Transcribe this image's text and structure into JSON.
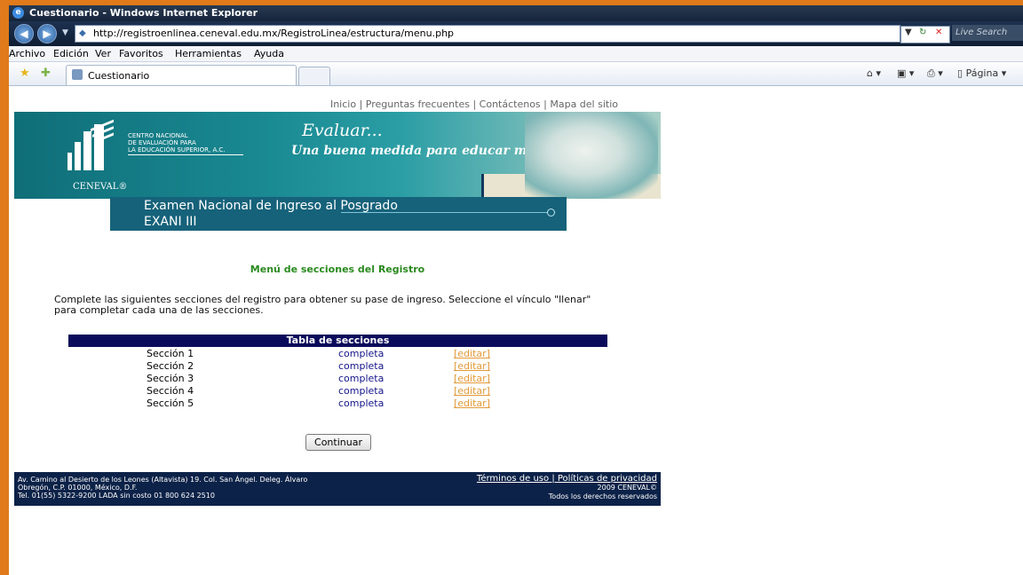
{
  "window": {
    "title": "Cuestionario - Windows Internet Explorer"
  },
  "address": {
    "url": "http://registroenlinea.ceneval.edu.mx/RegistroLinea/estructura/menu.php",
    "search_placeholder": "Live Search"
  },
  "menubar": {
    "items": [
      "Archivo",
      "Edición",
      "Ver",
      "Favoritos",
      "Herramientas",
      "Ayuda"
    ]
  },
  "tabbar": {
    "tab_label": "Cuestionario",
    "page_menu": "Página"
  },
  "site": {
    "toplinks": [
      "Inicio",
      "Preguntas frecuentes",
      "Contáctenos",
      "Mapa del sitio"
    ],
    "org_name": [
      "CENTRO NACIONAL",
      "DE EVALUACIÓN PARA",
      "LA EDUCACIÓN SUPERIOR, A.C."
    ],
    "logo_text": "CENEVAL®",
    "slogan_1": "Evaluar...",
    "slogan_2": "Una buena medida para educar mejor",
    "exam_line1": "Examen Nacional de Ingreso al Posgrado",
    "exam_line2": "EXANI III",
    "menu_title": "Menú de secciones del Registro",
    "intro": "Complete las siguientes secciones del registro para obtener su pase de ingreso. Seleccione el vínculo \"llenar\" para completar cada una de las secciones.",
    "table_title": "Tabla de secciones",
    "sections": [
      {
        "name": "Sección 1",
        "status": "completa",
        "action": "[editar]"
      },
      {
        "name": "Sección 2",
        "status": "completa",
        "action": "[editar]"
      },
      {
        "name": "Sección 3",
        "status": "completa",
        "action": "[editar]"
      },
      {
        "name": "Sección 4",
        "status": "completa",
        "action": "[editar]"
      },
      {
        "name": "Sección 5",
        "status": "completa",
        "action": "[editar]"
      }
    ],
    "continue_label": "Continuar",
    "footer": {
      "address_lines": [
        "Av. Camino al Desierto de los Leones (Altavista) 19. Col. San Ángel. Deleg. Álvaro",
        "Obregón, C.P. 01000, México, D.F.",
        "Tel. 01(55) 5322-9200 LADA sin costo 01 800 624 2510"
      ],
      "terms": "Términos de uso",
      "privacy": "Políticas de privacidad",
      "copyright": "2009 CENEVAL©",
      "rights": "Todos los derechos reservados"
    }
  },
  "colors": {
    "frame": "#e07a1a",
    "banner": "#1a8a93",
    "table_head": "#0b0b5c",
    "link_edit": "#e39a3a",
    "title_green": "#2a8a1f",
    "footer": "#0c2248"
  }
}
